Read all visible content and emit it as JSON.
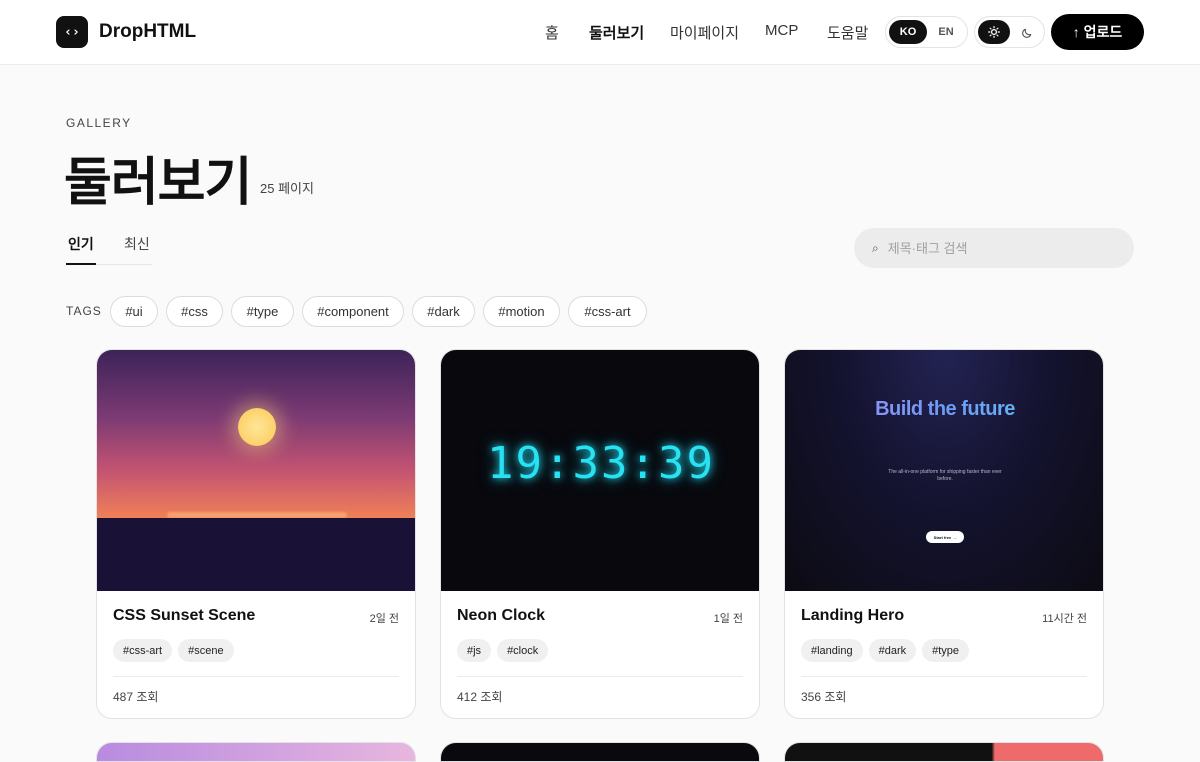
{
  "header": {
    "logo_icon": "‹›",
    "brand": "DropHTML",
    "nav": [
      {
        "label": "홈",
        "active": false
      },
      {
        "label": "둘러보기",
        "active": true
      },
      {
        "label": "마이페이지",
        "active": false
      },
      {
        "label": "MCP",
        "active": false
      },
      {
        "label": "도움말",
        "active": false
      }
    ],
    "lang": {
      "ko": "KO",
      "en": "EN",
      "selected": "KO"
    },
    "theme": {
      "light_icon": "sun-icon",
      "dark_icon": "moon-icon",
      "selected": "light"
    },
    "upload_label": "↑ 업로드"
  },
  "page": {
    "eyebrow": "GALLERY",
    "title": "둘러보기",
    "count": "25 페이지"
  },
  "tabs": [
    {
      "label": "인기",
      "active": true
    },
    {
      "label": "최신",
      "active": false
    }
  ],
  "search": {
    "placeholder": "제목·태그 검색",
    "icon": "search-icon"
  },
  "tags": {
    "label": "TAGS",
    "items": [
      "#ui",
      "#css",
      "#type",
      "#component",
      "#dark",
      "#motion",
      "#css-art"
    ]
  },
  "cards": [
    {
      "title": "CSS Sunset Scene",
      "time": "2일 전",
      "tags": [
        "#css-art",
        "#scene"
      ],
      "views": "487 조회"
    },
    {
      "title": "Neon Clock",
      "time": "1일 전",
      "tags": [
        "#js",
        "#clock"
      ],
      "views": "412 조회",
      "preview_time": "19:33:39"
    },
    {
      "title": "Landing Hero",
      "time": "11시간 전",
      "tags": [
        "#landing",
        "#dark",
        "#type"
      ],
      "views": "356 조회",
      "preview_heading": "Build the future",
      "preview_sub": "The all-in-one platform for shipping faster than ever before.",
      "preview_btn": "Start free →"
    }
  ],
  "colors": {
    "accent": "#111111",
    "neon": "#27e3f2",
    "background": "#fafafa"
  }
}
